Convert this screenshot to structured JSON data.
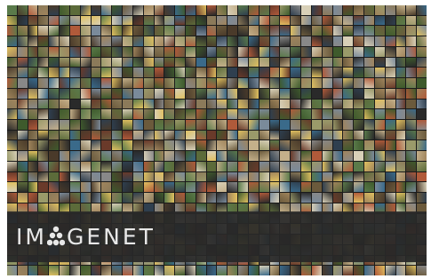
{
  "image": {
    "description_free_logo": {
      "part1": "IM",
      "part2": "GENET"
    },
    "colors": {
      "banner": "#282828",
      "logo_text": "#e8e8e8",
      "mosaic_palette": [
        "#6b5a3c",
        "#3e5a2c",
        "#8b7a5a",
        "#2f3f4f",
        "#a0845c",
        "#5c6b3a",
        "#c4b08a",
        "#4a3a2a",
        "#7a8a9a",
        "#b05a3a",
        "#2a2a2a",
        "#d8d0b8",
        "#3a6a8a",
        "#9a9a6a",
        "#6a3a2a",
        "#e0c060",
        "#5a7a4a",
        "#888888"
      ]
    }
  }
}
